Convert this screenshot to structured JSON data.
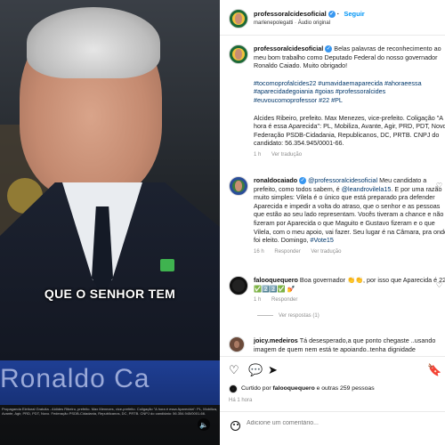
{
  "video": {
    "caption": "QUE O SENHOR TEM",
    "name_banner": "Ronaldo Ca",
    "legal": "Propaganda Eleitoral Gratuita - Aldides Ribeiro, prefeito. Max Menezes, vice-prefeito. Coligação \"A hora é essa Aparecida\": PL, Mobiliza, Avante, Agir, PRD, PDT, Novo. Federação PSDB-Cidadania, Republicanos, DC, PRTB. CNPJ do candidato: 56.354.945/0001-66."
  },
  "header": {
    "username": "professoralcidesoficial",
    "follow": "Seguir",
    "subtitle": "marlenepolegatti · Áudio original"
  },
  "caption_post": {
    "username": "professoralcidesoficial",
    "text": "Belas palavras de reconhecimento ao meu bom trabalho como Deputado Federal do nosso governador Ronaldo Caiado. Muito obrigado!",
    "hashtags": "#tocomoprofalcides22 #umavidaemaparecida #ahoraeessa #aparecidadegoiania #goias #professoralcides #euvoucomoprofessor #22 #PL",
    "legal": "Alcides Ribeiro, prefeito. Max Menezes, vice-prefeito. Coligação \"A hora é essa Aparecida\": PL, Mobiliza, Avante, Agir, PRD, PDT, Novo. Federação PSDB-Cidadania, Republicanos, DC, PRTB. CNPJ do candidato: 56.354.945/0001-66.",
    "time": "1 h",
    "see_translation": "Ver tradução"
  },
  "comments": [
    {
      "username": "ronaldocaiado",
      "text_a": "@professoralcidesoficial",
      "text_b": " Meu candidato a prefeito, como todos sabem, é ",
      "text_c": "@leandrovilela15",
      "text_d": ". E por uma razão muito simples: Vilela é o único que está preparado pra defender Aparecida e impedir a volta do atraso, que o senhor e as pessoas que estão ao seu lado representam. Vocês tiveram a chance e não fizeram por Aparecida o que Maguito e Gustavo fizeram e o que Vilela, com o meu apoio, vai fazer. Seu lugar é na Câmara, pra onde foi eleito. Domingo, ",
      "text_e": "#Vote15",
      "time": "16 h",
      "reply": "Responder",
      "see_translation": "Ver tradução"
    },
    {
      "username": "falooquequero",
      "text": "Boa governador 👏👏, por isso que Aparecida é 22 ✅2️⃣2️⃣✅ 💅",
      "time": "1 h",
      "reply": "Responder",
      "replies": "Ver respostas (1)"
    },
    {
      "username": "joicy.medeiros",
      "text": "Tá desesperado,a que ponto chegaste ..usando imagem de quem nem está te apoiando..tenha dignidade"
    }
  ],
  "likes": {
    "text_prefix": "Curtido por ",
    "user": "falooquequero",
    "text_suffix": " e outras 259 pessoas"
  },
  "post_time": "Há 1 hora",
  "comment_placeholder": "Adicione um comentário..."
}
